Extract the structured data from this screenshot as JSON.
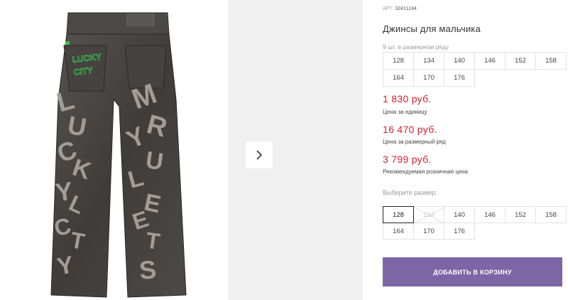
{
  "product": {
    "art_label": "АРТ:",
    "art_number": "32411244",
    "title": "Джинсы для мальчика",
    "row_note": "9 шт. в размерном ряду",
    "row_sizes": [
      "128",
      "134",
      "140",
      "146",
      "152",
      "158",
      "164",
      "170",
      "176"
    ],
    "prices": [
      {
        "value": "1 830 руб.",
        "label": "Цена за единицу"
      },
      {
        "value": "16 470 руб.",
        "label": "Цена за размерный ряд"
      },
      {
        "value": "3 799 руб.",
        "label": "Рекомендуемая розничная цена"
      }
    ],
    "choose_label": "Выберите размер:",
    "select_sizes": [
      "128",
      "134",
      "140",
      "146",
      "152",
      "158",
      "164",
      "170",
      "176"
    ],
    "selected_size": "128",
    "unavailable_size": "134",
    "cart_button": "Добавить в корзину"
  },
  "gallery": {
    "next_icon": "chevron-right-icon"
  },
  "colors": {
    "price": "#d6202a",
    "button": "#7c66a6",
    "jeans": "#4a4745",
    "letters": "#a29c98"
  }
}
